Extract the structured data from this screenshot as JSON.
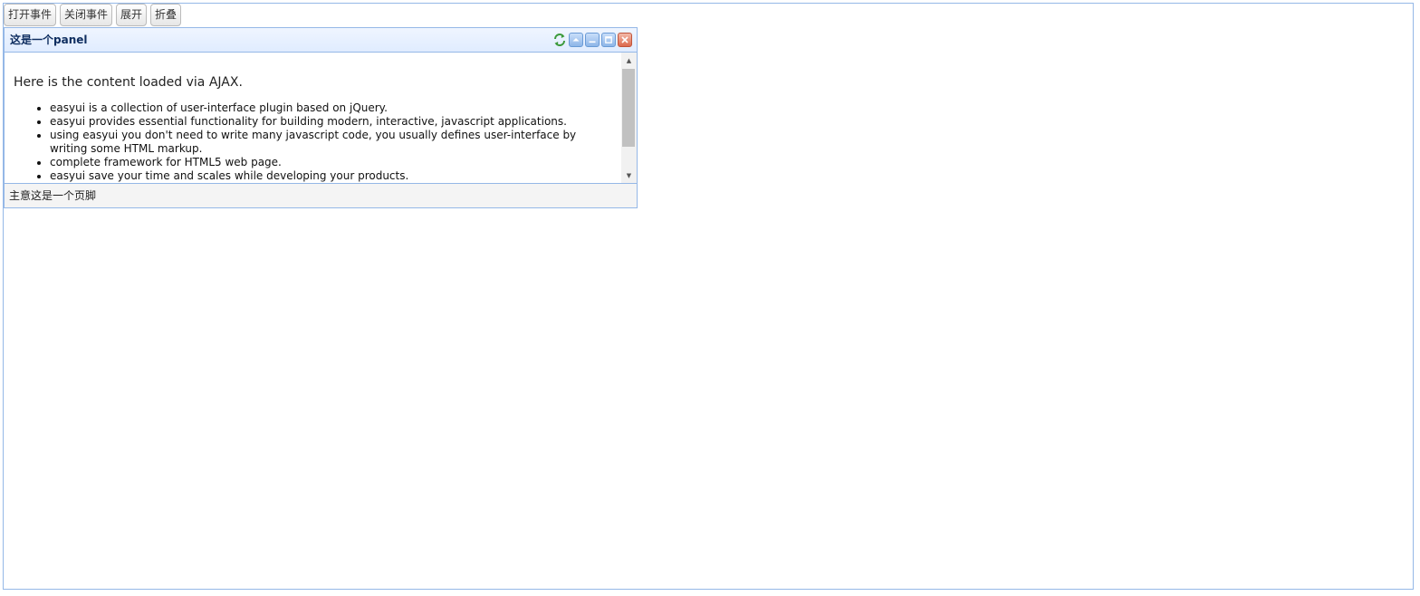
{
  "toolbar": {
    "buttons": [
      {
        "label": "打开事件"
      },
      {
        "label": "关闭事件"
      },
      {
        "label": "展开"
      },
      {
        "label": "折叠"
      }
    ]
  },
  "panel": {
    "title": "这是一个panel",
    "tools": [
      "refresh-icon",
      "collapse-icon",
      "minimize-icon",
      "maximize-icon",
      "close-icon"
    ],
    "body": {
      "intro": "Here is the content loaded via AJAX.",
      "items": [
        "easyui is a collection of user-interface plugin based on jQuery.",
        "easyui provides essential functionality for building modern, interactive, javascript applications.",
        "using easyui you don't need to write many javascript code, you usually defines user-interface by writing some HTML markup.",
        "complete framework for HTML5 web page.",
        "easyui save your time and scales while developing your products."
      ]
    },
    "footer": "主意这是一个页脚"
  },
  "colors": {
    "border": "#95b8e7",
    "header_gradient_top": "#eff5ff",
    "header_gradient_bottom": "#e0ecff",
    "title_text": "#0e2d5f",
    "footer_bg": "#f4f4f4",
    "close_tool": "#dc6a4e"
  }
}
